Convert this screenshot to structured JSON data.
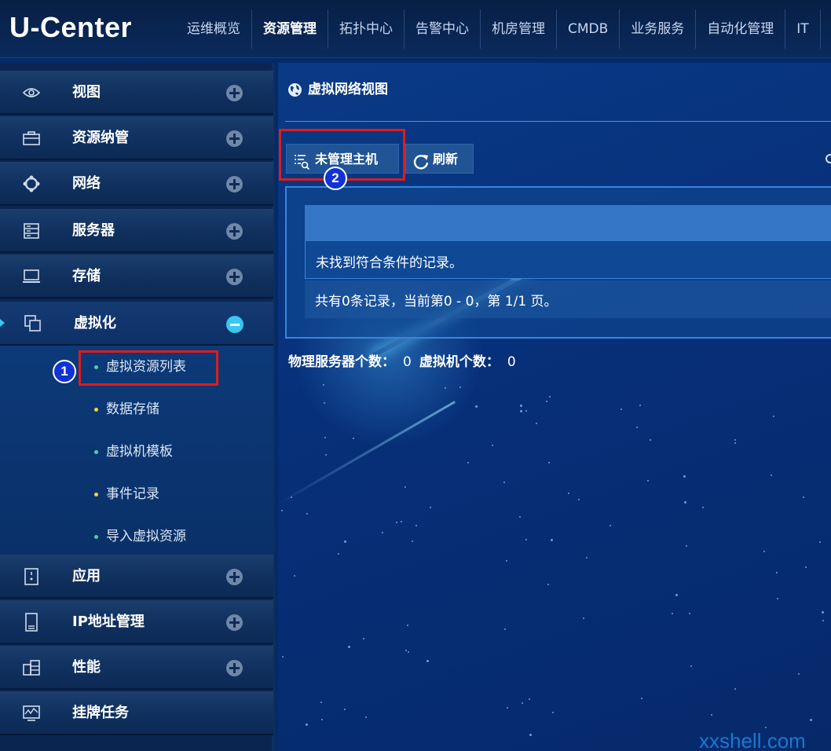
{
  "app": {
    "logo": "U-Center"
  },
  "nav": {
    "items": [
      "运维概览",
      "资源管理",
      "拓扑中心",
      "告警中心",
      "机房管理",
      "CMDB",
      "业务服务",
      "自动化管理",
      "IT"
    ],
    "active": "资源管理"
  },
  "sidebar": {
    "items": [
      {
        "label": "视图",
        "icon": "eye-icon"
      },
      {
        "label": "资源纳管",
        "icon": "briefcase-icon"
      },
      {
        "label": "网络",
        "icon": "network-icon"
      },
      {
        "label": "服务器",
        "icon": "server-icon"
      },
      {
        "label": "存储",
        "icon": "storage-icon"
      },
      {
        "label": "虚拟化",
        "icon": "virtualization-icon",
        "expanded": true
      },
      {
        "label": "应用",
        "icon": "application-icon"
      },
      {
        "label": "IP地址管理",
        "icon": "ip-device-icon"
      },
      {
        "label": "性能",
        "icon": "performance-icon"
      },
      {
        "label": "挂牌任务",
        "icon": "task-icon"
      }
    ],
    "submenu": [
      {
        "label": "虚拟资源列表",
        "dot_color": "#4fd1a5"
      },
      {
        "label": "数据存储",
        "dot_color": "#f5d23a"
      },
      {
        "label": "虚拟机模板",
        "dot_color": "#4fd1a5"
      },
      {
        "label": "事件记录",
        "dot_color": "#f5d23a"
      },
      {
        "label": "导入虚拟资源",
        "dot_color": "#4fd1a5"
      }
    ]
  },
  "main": {
    "title": "虚拟网络视图",
    "buttons": {
      "unmanaged_hosts": "未管理主机",
      "refresh": "刷新"
    },
    "table": {
      "empty_message": "未找到符合条件的记录。",
      "footer": "共有0条记录，当前第0 - 0，第 1/1 页。"
    },
    "stats": {
      "physical_servers_label": "物理服务器个数：",
      "physical_servers_value": "0",
      "vms_label": "虚拟机个数：",
      "vms_value": "0"
    }
  },
  "annotations": {
    "badge_1": "1",
    "badge_2": "2"
  },
  "watermark": "xxshell.com",
  "colors": {
    "accent": "#37c7f2",
    "highlight": "#e01b1b",
    "badge": "#1133d6"
  }
}
